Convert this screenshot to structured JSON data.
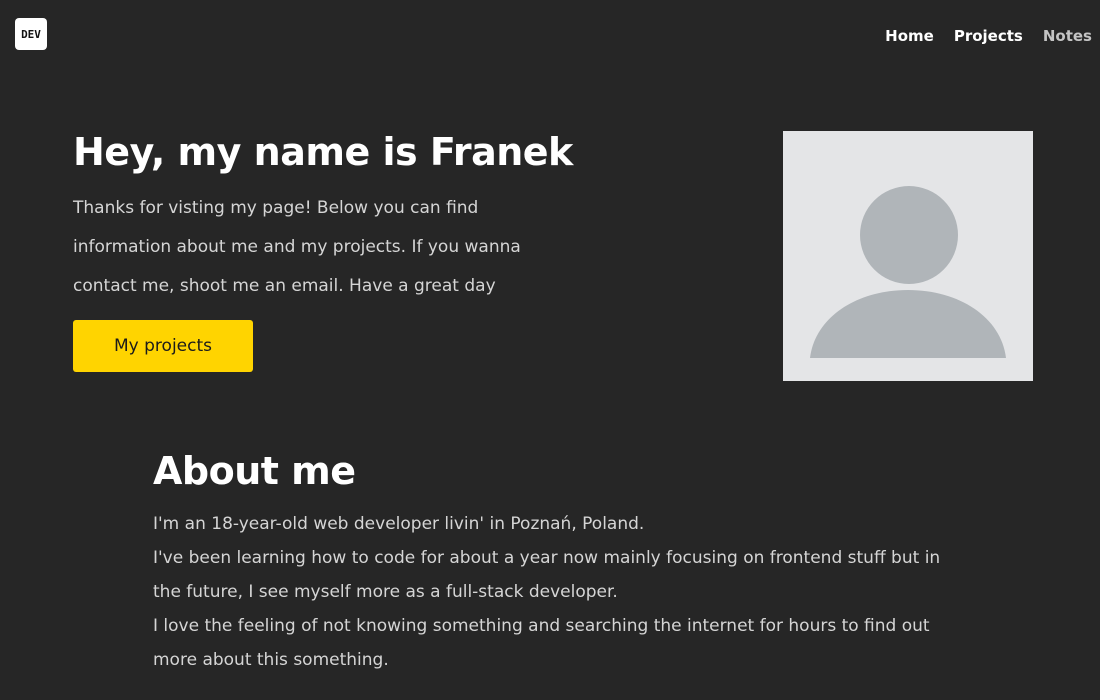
{
  "header": {
    "logo_text": "DEV",
    "nav": [
      {
        "label": "Home"
      },
      {
        "label": "Projects"
      },
      {
        "label": "Notes"
      }
    ]
  },
  "hero": {
    "title": "Hey, my name is Franek",
    "text": "Thanks for visting my page! Below you can find information about me and my projects. If you wanna contact me, shoot me an email. Have a great day",
    "button_label": "My projects",
    "avatar_icon": "user-avatar-placeholder-icon"
  },
  "about": {
    "title": "About me",
    "paragraphs": [
      "I'm an 18-year-old web developer livin' in Poznań, Poland.",
      "I've been learning how to code for about a year now mainly focusing on frontend stuff but in the future, I see myself more as a full-stack developer.",
      "I love the feeling of not knowing something and searching the internet for hours to find out more about this something."
    ]
  },
  "colors": {
    "background": "#262626",
    "accent": "#ffd400",
    "avatar_bg": "#e4e5e7",
    "avatar_figure": "#b0b5b9"
  }
}
